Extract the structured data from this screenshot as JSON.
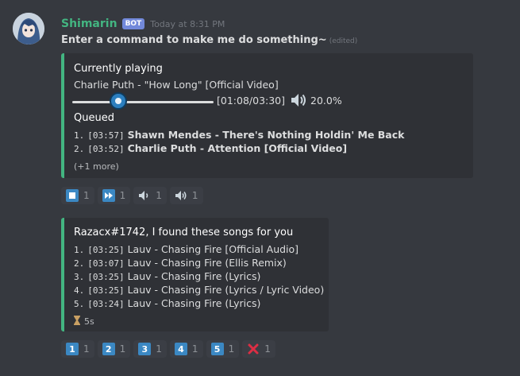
{
  "message": {
    "username": "Shimarin",
    "bot_tag": "BOT",
    "timestamp": "Today at 8:31 PM",
    "text": "Enter a command to make me do something~",
    "edited": "(edited)"
  },
  "player_embed": {
    "color": "#43b581",
    "title": "Currently playing",
    "now_playing": "Charlie Puth - \"How Long\" [Official Video]",
    "time": "[01:08/03:30]",
    "progress": 0.324,
    "volume": "20.0%",
    "queue_title": "Queued",
    "queue": [
      {
        "num": "1.",
        "duration": "[03:57]",
        "title": "Shawn Mendes - There's Nothing Holdin' Me Back"
      },
      {
        "num": "2.",
        "duration": "[03:52]",
        "title": "Charlie Puth - Attention [Official Video]"
      }
    ],
    "more": "(+1 more)"
  },
  "player_reactions": [
    {
      "icon": "stop-icon",
      "count": "1"
    },
    {
      "icon": "fast-forward-icon",
      "count": "1"
    },
    {
      "icon": "volume-down-icon",
      "count": "1"
    },
    {
      "icon": "volume-up-icon",
      "count": "1"
    }
  ],
  "search_embed": {
    "color": "#43b581",
    "title": "Razacx#1742, I found these songs for you",
    "results": [
      {
        "num": "1.",
        "duration": "[03:25]",
        "title": "Lauv - Chasing Fire [Official Audio]"
      },
      {
        "num": "2.",
        "duration": "[03:07]",
        "title": "Lauv - Chasing Fire (Ellis Remix)"
      },
      {
        "num": "3.",
        "duration": "[03:25]",
        "title": "Lauv - Chasing Fire (Lyrics)"
      },
      {
        "num": "4.",
        "duration": "[03:25]",
        "title": "Lauv - Chasing Fire (Lyrics / Lyric Video)"
      },
      {
        "num": "5.",
        "duration": "[03:24]",
        "title": "Lauv - Chasing Fire (Lyrics)"
      }
    ],
    "timer": "5s"
  },
  "search_reactions": [
    {
      "icon": "keycap-1-icon",
      "label": "1",
      "count": "1"
    },
    {
      "icon": "keycap-2-icon",
      "label": "2",
      "count": "1"
    },
    {
      "icon": "keycap-3-icon",
      "label": "3",
      "count": "1"
    },
    {
      "icon": "keycap-4-icon",
      "label": "4",
      "count": "1"
    },
    {
      "icon": "keycap-5-icon",
      "label": "5",
      "count": "1"
    },
    {
      "icon": "cross-mark-icon",
      "count": "1"
    }
  ]
}
